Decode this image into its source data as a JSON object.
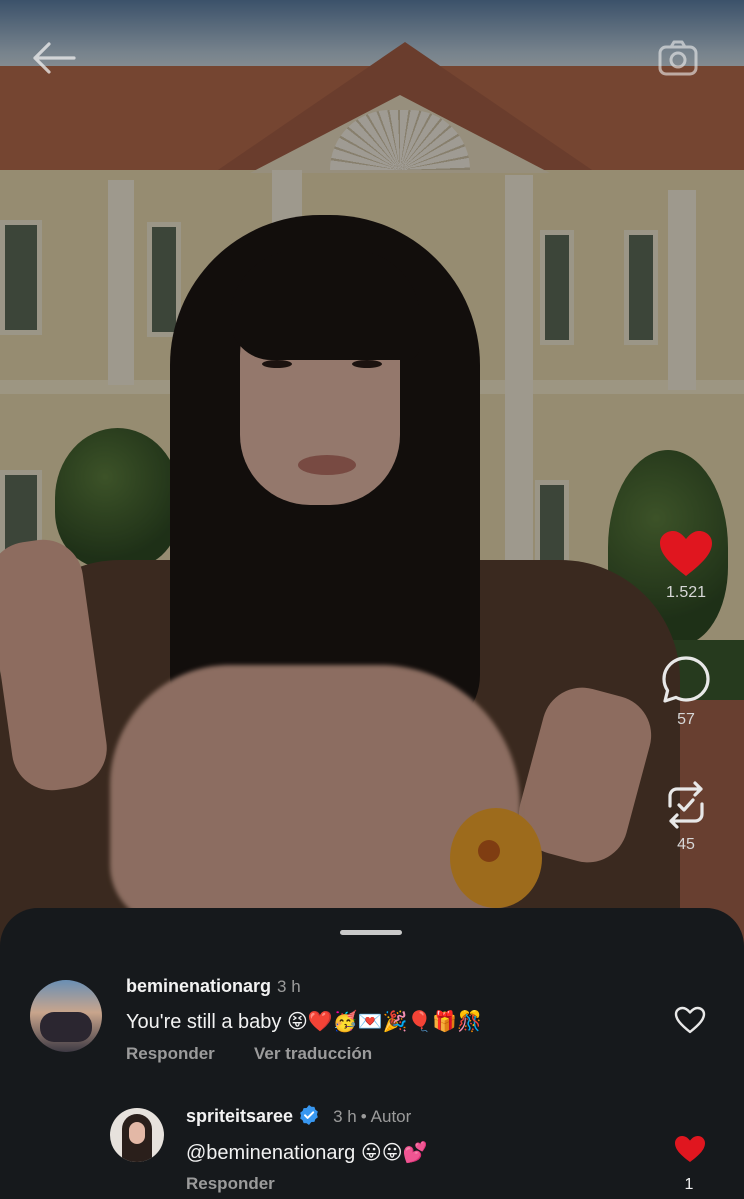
{
  "video": {
    "likes_count": "1.521",
    "comments_count": "57",
    "reposts_count": "45",
    "liked": true,
    "accent_like": "#e0161f"
  },
  "icons": {
    "back": "arrow-left-icon",
    "camera": "camera-icon",
    "like": "heart-icon",
    "comment": "speech-bubble-icon",
    "repost": "repost-icon",
    "verified": "verified-badge-icon"
  },
  "comments": [
    {
      "username": "beminenationarg",
      "time": "3 h",
      "text": "You're still a baby 😝❤️🥳💌🎉🎈🎁🎊",
      "reply_label": "Responder",
      "translate_label": "Ver traducción",
      "liked": false
    },
    {
      "username": "spriteitsaree",
      "verified": true,
      "time": "3 h",
      "author_label": "Autor",
      "text": "@beminenationarg 😛😛💕",
      "reply_label": "Responder",
      "liked": true,
      "like_count": "1"
    }
  ]
}
